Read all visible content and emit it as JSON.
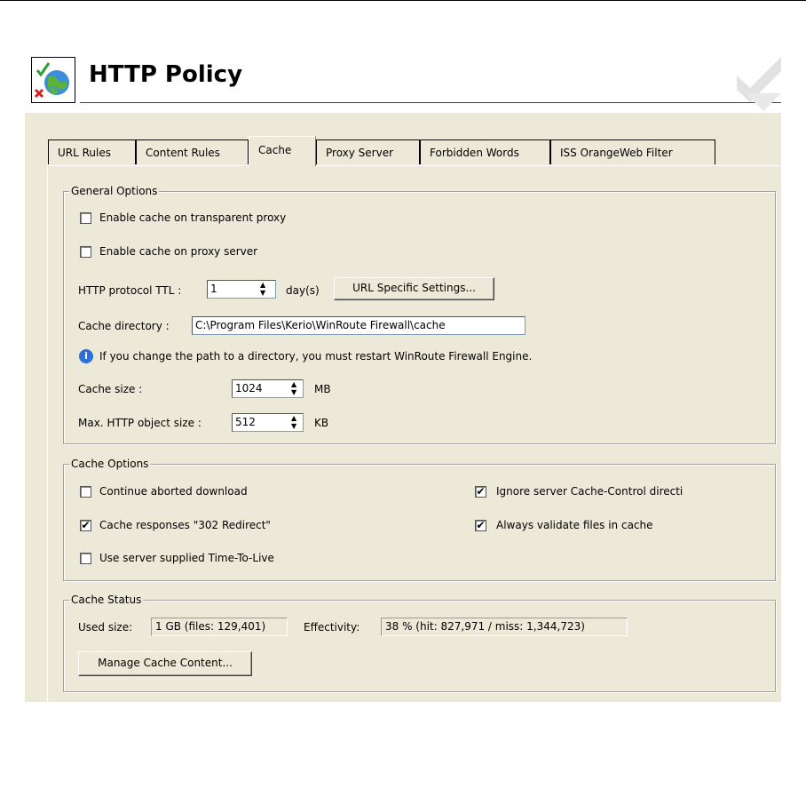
{
  "page": {
    "title": "HTTP Policy"
  },
  "tabs": [
    {
      "label": "URL Rules"
    },
    {
      "label": "Content Rules"
    },
    {
      "label": "Cache",
      "active": true
    },
    {
      "label": "Proxy Server"
    },
    {
      "label": "Forbidden Words"
    },
    {
      "label": "ISS OrangeWeb Filter"
    }
  ],
  "general": {
    "legend": "General Options",
    "enable_transparent": {
      "label": "Enable cache on transparent proxy",
      "checked": false
    },
    "enable_proxy": {
      "label": "Enable cache on proxy server",
      "checked": false
    },
    "ttl_label": "HTTP protocol TTL :",
    "ttl_value": "1",
    "ttl_unit": "day(s)",
    "url_specific_button": "URL Specific Settings...",
    "cache_dir_label": "Cache directory :",
    "cache_dir_value": "C:\\Program Files\\Kerio\\WinRoute Firewall\\cache",
    "info_text": "If you change the path to a directory, you must restart WinRoute Firewall Engine.",
    "cache_size_label": "Cache size :",
    "cache_size_value": "1024",
    "cache_size_unit": "MB",
    "max_obj_label": "Max. HTTP object size :",
    "max_obj_value": "512",
    "max_obj_unit": "KB"
  },
  "cache_options": {
    "legend": "Cache Options",
    "continue_aborted": {
      "label": "Continue aborted download",
      "checked": false
    },
    "cache_302": {
      "label": "Cache responses \"302 Redirect\"",
      "checked": true
    },
    "use_server_ttl": {
      "label": "Use server supplied Time-To-Live",
      "checked": false
    },
    "ignore_cache_control": {
      "label": "Ignore server Cache-Control directi",
      "checked": true
    },
    "always_validate": {
      "label": "Always validate files in cache",
      "checked": true
    }
  },
  "status": {
    "legend": "Cache Status",
    "used_label": "Used size:",
    "used_value": "1 GB (files: 129,401)",
    "effectivity_label": "Effectivity:",
    "effectivity_value": "38 % (hit: 827,971 / miss: 1,344,723)",
    "manage_button": "Manage Cache Content..."
  },
  "check_glyph": "✔"
}
